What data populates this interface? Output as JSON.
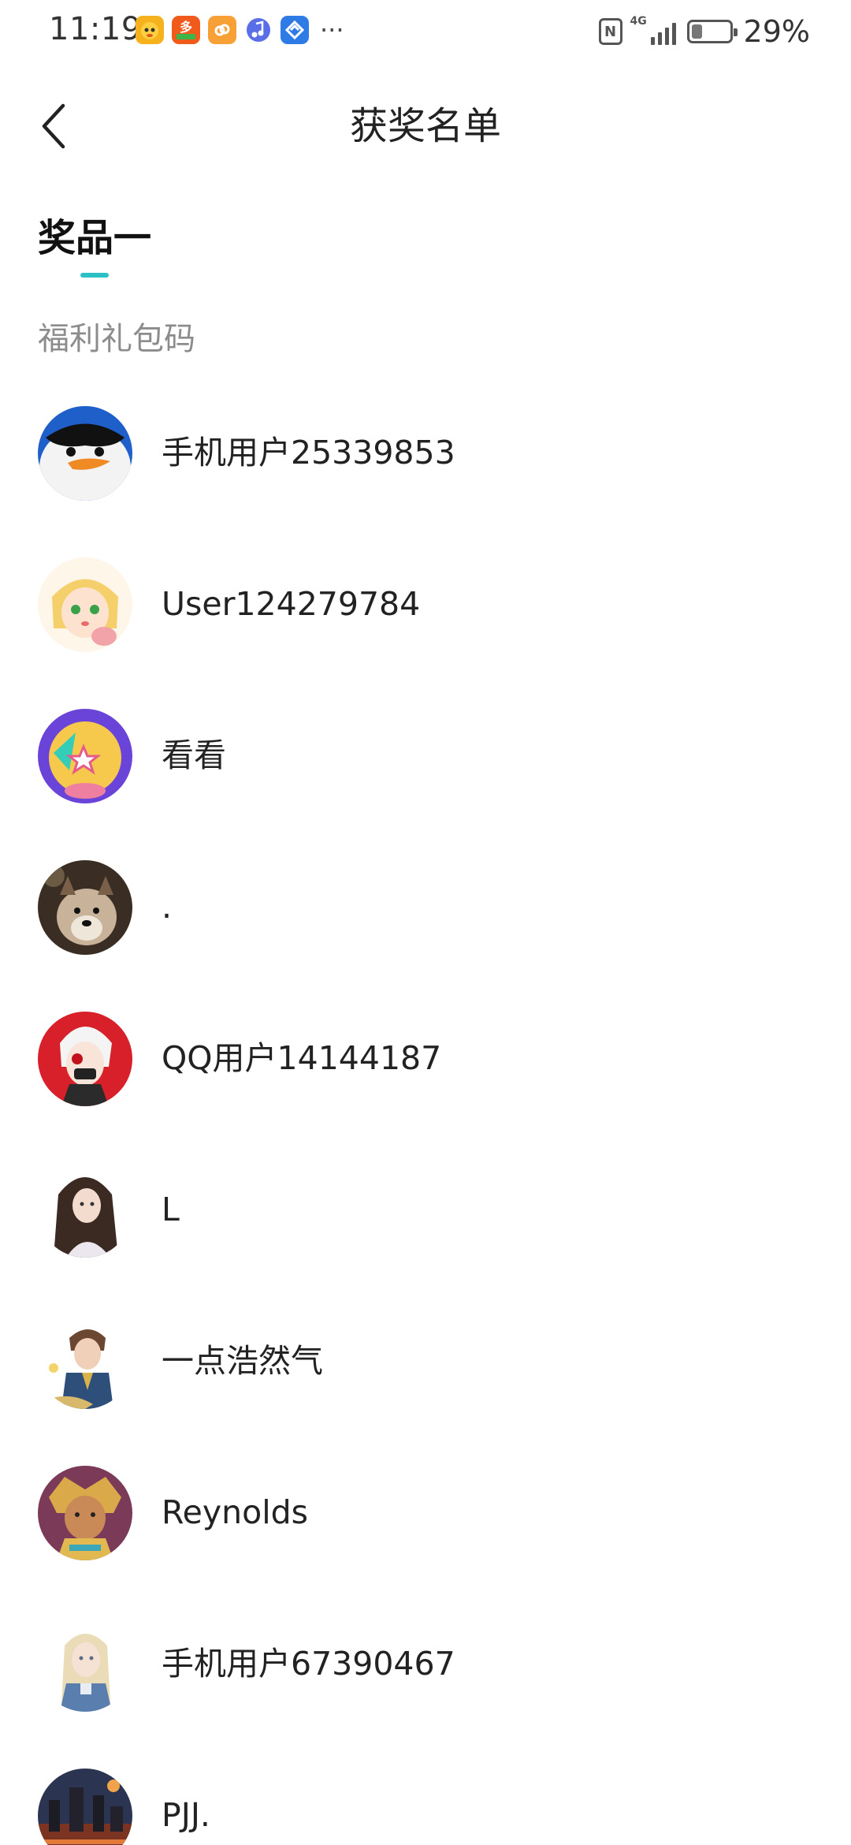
{
  "status_bar": {
    "time": "11:19",
    "more": "···",
    "nfc": "N",
    "network": "4G",
    "battery": "29%",
    "battery_level": 0.29
  },
  "header": {
    "back_icon": "chevron-left-icon",
    "title": "获奖名单"
  },
  "tab": {
    "label": "奖品一",
    "accent_color": "#2bc0c4"
  },
  "prize": {
    "name": "福利礼包码"
  },
  "winners": [
    {
      "name": "手机用户25339853",
      "avatar": "penguin-avatar"
    },
    {
      "name": "User124279784",
      "avatar": "anime-girl-avatar"
    },
    {
      "name": "看看",
      "avatar": "cartoon-star-avatar"
    },
    {
      "name": ".",
      "avatar": "dog-avatar"
    },
    {
      "name": "QQ用户14144187",
      "avatar": "masked-character-avatar"
    },
    {
      "name": "L",
      "avatar": "dark-hair-girl-avatar"
    },
    {
      "name": "一点浩然气",
      "avatar": "warrior-avatar"
    },
    {
      "name": "Reynolds",
      "avatar": "golden-hero-avatar"
    },
    {
      "name": "手机用户67390467",
      "avatar": "blonde-girl-avatar"
    },
    {
      "name": "PJJ.",
      "avatar": "city-night-avatar"
    }
  ]
}
